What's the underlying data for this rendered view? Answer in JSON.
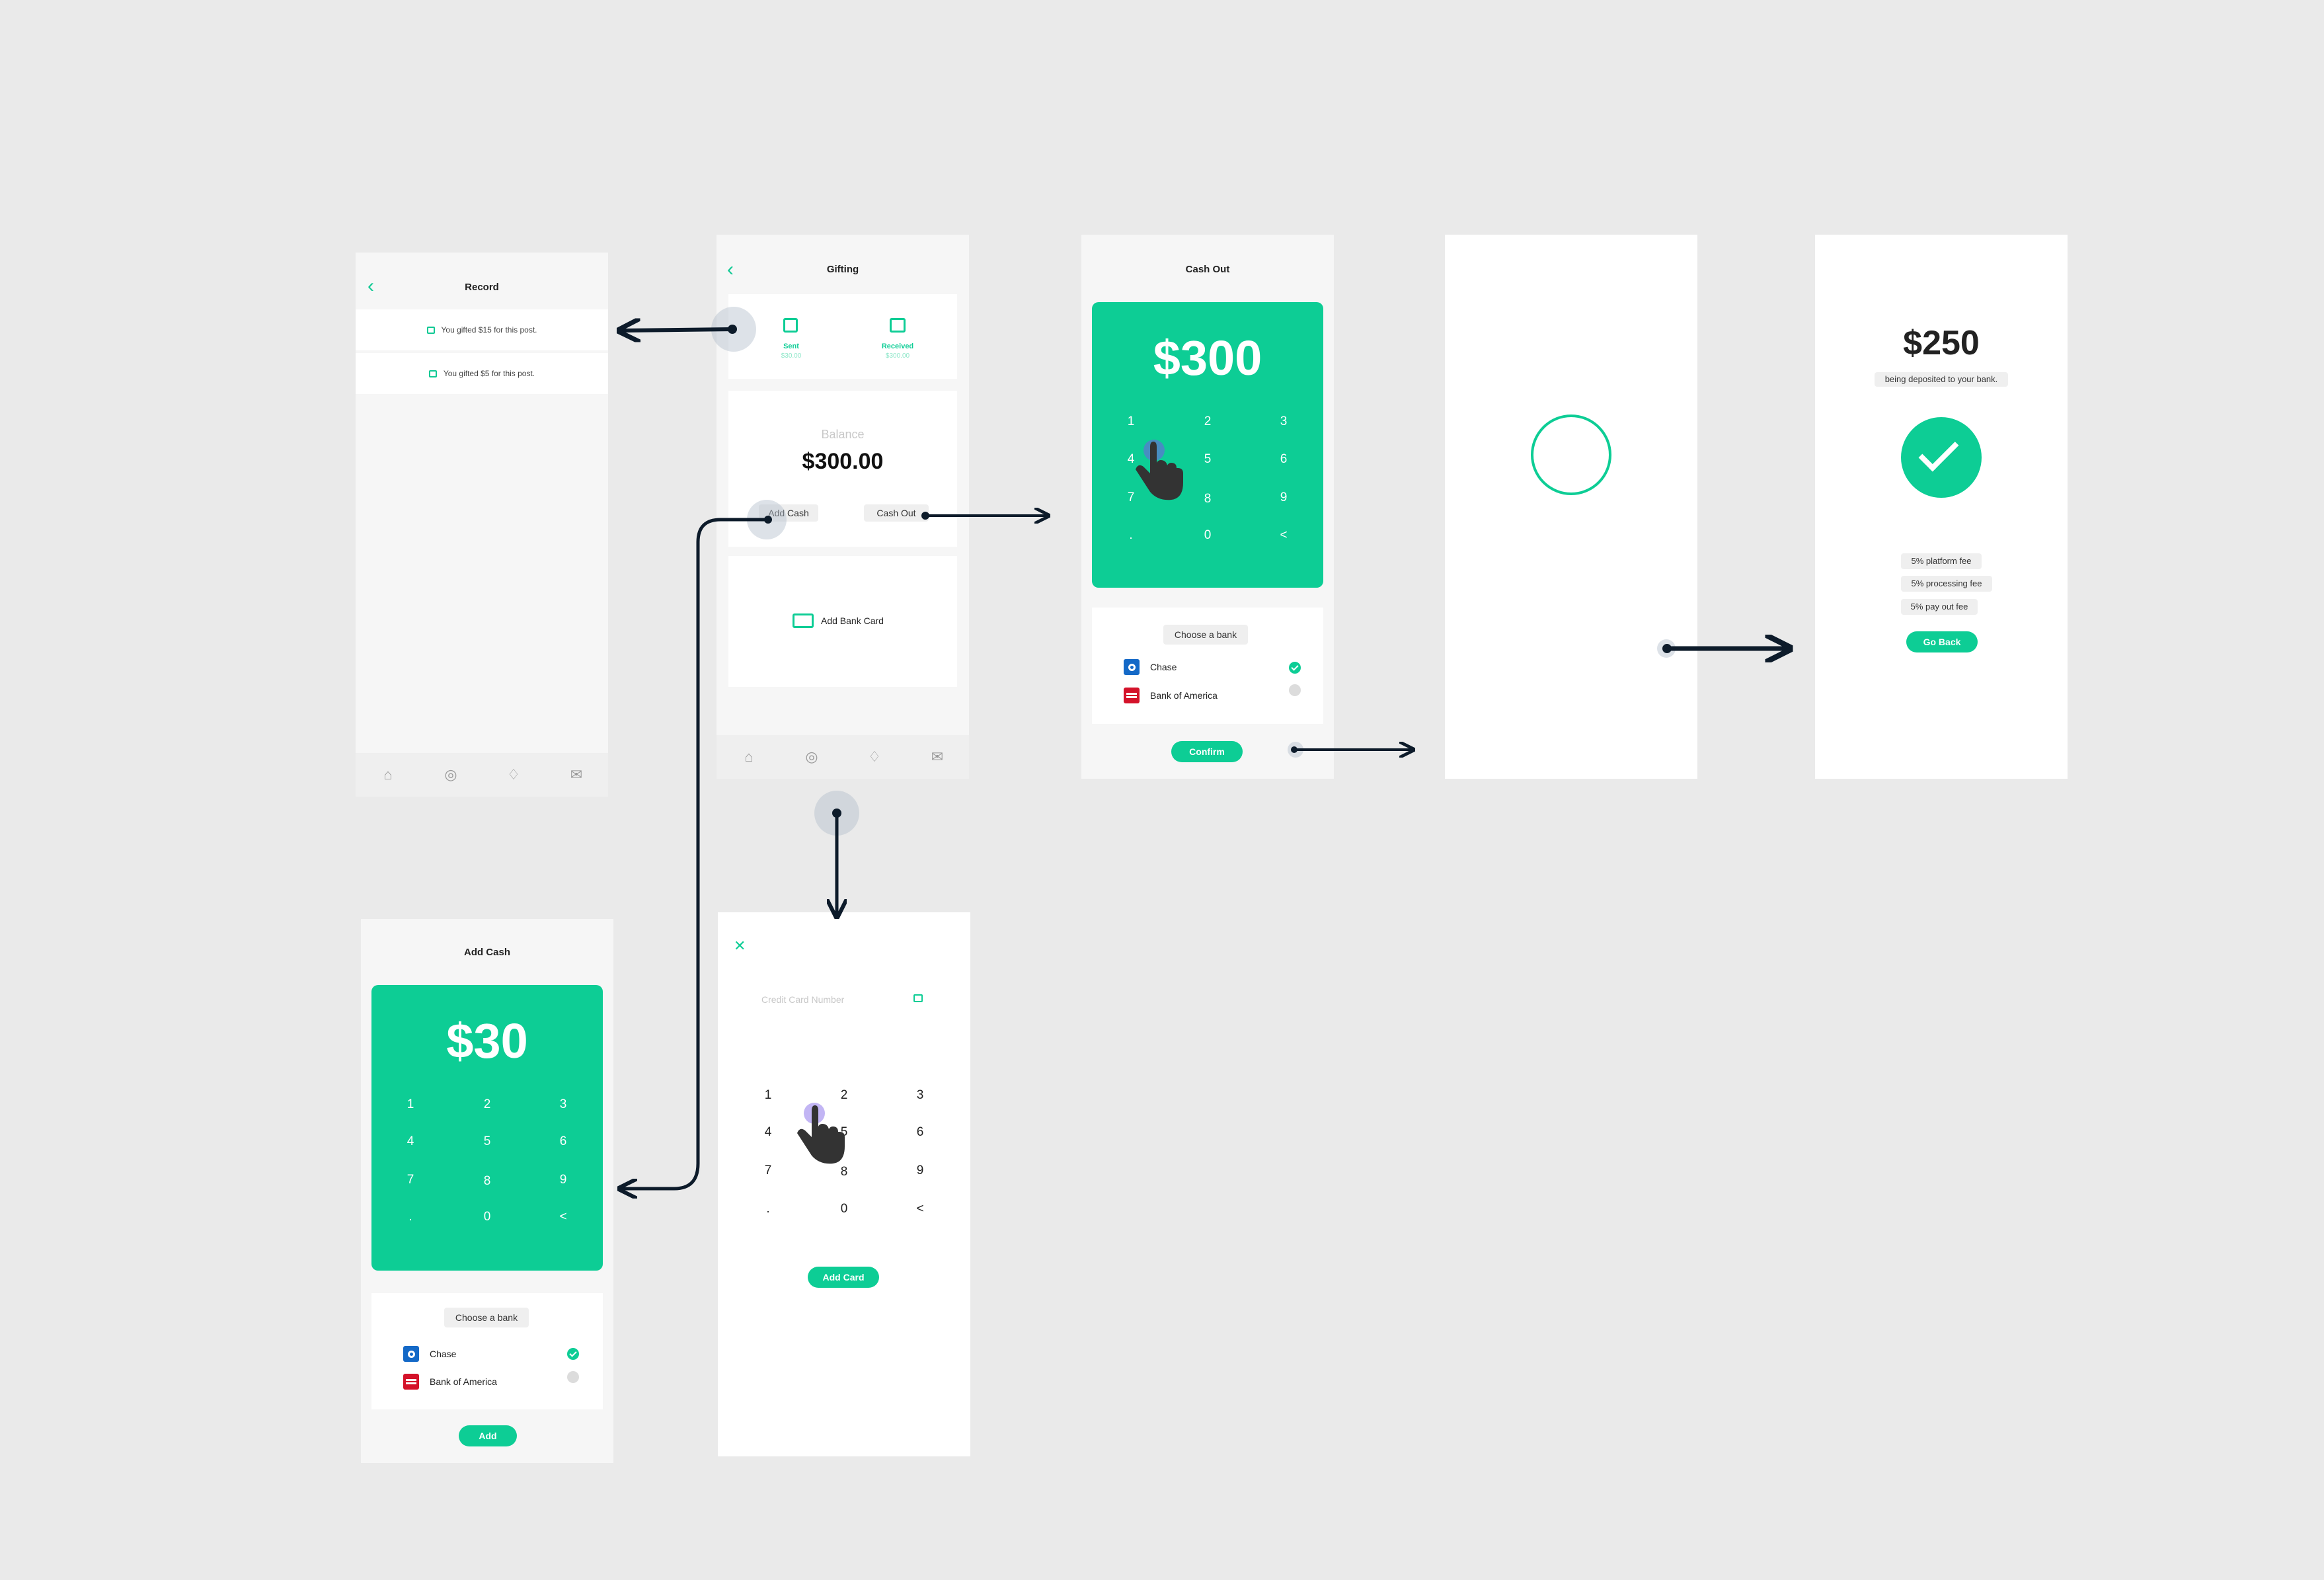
{
  "colors": {
    "accent": "#0dcd95",
    "connector": "#0d1b2a",
    "background": "#eaeaea"
  },
  "record": {
    "title": "Record",
    "items": [
      "You gifted $15 for this post.",
      "You gifted $5 for this post."
    ],
    "back_icon": "chevron-left-icon"
  },
  "gifting": {
    "title": "Gifting",
    "sent_label": "Sent",
    "sent_value": "$30.00",
    "received_label": "Received",
    "received_value": "$300.00",
    "balance_label": "Balance",
    "balance_value": "$300.00",
    "add_cash": "Add Cash",
    "cash_out": "Cash Out",
    "add_bank_card": "Add Bank Card"
  },
  "cash_out": {
    "title": "Cash Out",
    "amount": "$300",
    "keys": [
      "1",
      "2",
      "3",
      "4",
      "5",
      "6",
      "7",
      "8",
      "9",
      ".",
      "0",
      "<"
    ],
    "choose_bank": "Choose a bank",
    "banks": [
      "Chase",
      "Bank of America"
    ],
    "confirm": "Confirm"
  },
  "loading": {
    "icon": "loading-ring-icon"
  },
  "success": {
    "amount": "$250",
    "subtitle": "being deposited to your bank.",
    "fees": [
      "5% platform fee",
      "5% processing fee",
      "5% pay out fee"
    ],
    "go_back": "Go Back"
  },
  "add_cash": {
    "title": "Add Cash",
    "amount": "$30",
    "keys": [
      "1",
      "2",
      "3",
      "4",
      "5",
      "6",
      "7",
      "8",
      "9",
      ".",
      "0",
      "<"
    ],
    "choose_bank": "Choose a bank",
    "banks": [
      "Chase",
      "Bank of America"
    ],
    "add": "Add"
  },
  "add_card": {
    "placeholder": "Credit Card Number",
    "keys": [
      "1",
      "2",
      "3",
      "4",
      "5",
      "6",
      "7",
      "8",
      "9",
      ".",
      "0",
      "<"
    ],
    "add_card": "Add Card"
  },
  "nav_icons": [
    "home-icon",
    "compass-icon",
    "bell-icon",
    "mail-icon"
  ]
}
